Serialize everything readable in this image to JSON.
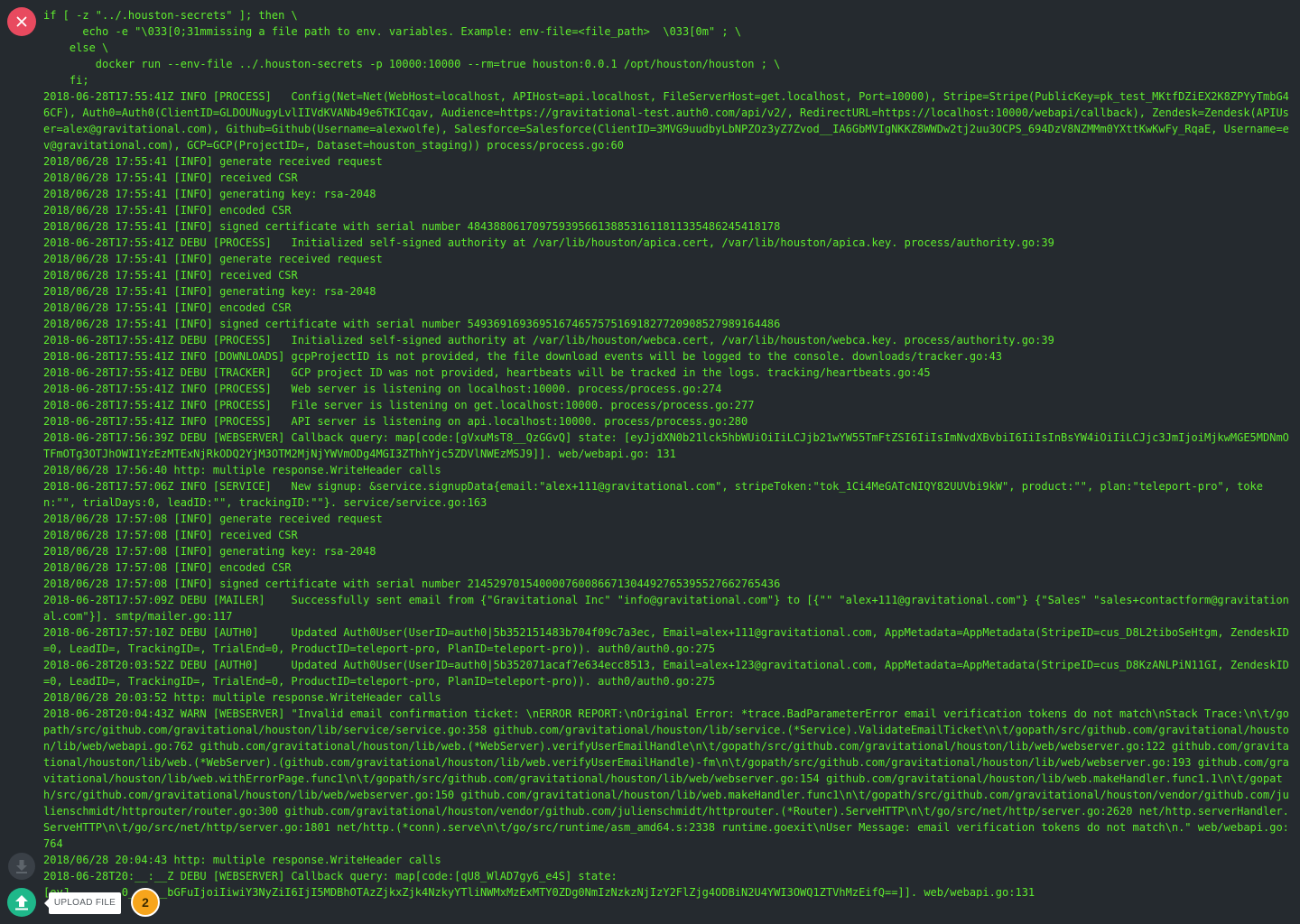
{
  "log_lines": [
    "if [ -z \"../.houston-secrets\" ]; then \\",
    "      echo -e \"\\033[0;31mmissing a file path to env. variables. Example: env-file=<file_path>  \\033[0m\" ; \\",
    "    else \\",
    "        docker run --env-file ../.houston-secrets -p 10000:10000 --rm=true houston:0.0.1 /opt/houston/houston ; \\",
    "    fi;",
    "2018-06-28T17:55:41Z INFO [PROCESS]   Config(Net=Net(WebHost=localhost, APIHost=api.localhost, FileServerHost=get.localhost, Port=10000), Stripe=Stripe(PublicKey=pk_test_MKtfDZiEX2K8ZPYyTmbG46CF), Auth0=Auth0(ClientID=GLDOUNugyLvlIIVdKVANb49e6TKICqav, Audience=https://gravitational-test.auth0.com/api/v2/, RedirectURL=https://localhost:10000/webapi/callback), Zendesk=Zendesk(APIUser=alex@gravitational.com), Github=Github(Username=alexwolfe), Salesforce=Salesforce(ClientID=3MVG9uudbyLbNPZOz3yZ7Zvod__IA6GbMVIgNKKZ8WWDw2tj2uu3OCPS_694DzV8NZMMm0YXttKwKwFy_RqaE, Username=ev@gravitational.com), GCP=GCP(ProjectID=, Dataset=houston_staging)) process/process.go:60",
    "2018/06/28 17:55:41 [INFO] generate received request",
    "2018/06/28 17:55:41 [INFO] received CSR",
    "2018/06/28 17:55:41 [INFO] generating key: rsa-2048",
    "2018/06/28 17:55:41 [INFO] encoded CSR",
    "2018/06/28 17:55:41 [INFO] signed certificate with serial number 484388061709759395661388531611811335486245418178",
    "2018-06-28T17:55:41Z DEBU [PROCESS]   Initialized self-signed authority at /var/lib/houston/apica.cert, /var/lib/houston/apica.key. process/authority.go:39",
    "2018/06/28 17:55:41 [INFO] generate received request",
    "2018/06/28 17:55:41 [INFO] received CSR",
    "2018/06/28 17:55:41 [INFO] generating key: rsa-2048",
    "2018/06/28 17:55:41 [INFO] encoded CSR",
    "2018/06/28 17:55:41 [INFO] signed certificate with serial number 549369169369516746575751691827720908527989164486",
    "2018-06-28T17:55:41Z DEBU [PROCESS]   Initialized self-signed authority at /var/lib/houston/webca.cert, /var/lib/houston/webca.key. process/authority.go:39",
    "2018-06-28T17:55:41Z INFO [DOWNLOADS] gcpProjectID is not provided, the file download events will be logged to the console. downloads/tracker.go:43",
    "2018-06-28T17:55:41Z DEBU [TRACKER]   GCP project ID was not provided, heartbeats will be tracked in the logs. tracking/heartbeats.go:45",
    "2018-06-28T17:55:41Z INFO [PROCESS]   Web server is listening on localhost:10000. process/process.go:274",
    "2018-06-28T17:55:41Z INFO [PROCESS]   File server is listening on get.localhost:10000. process/process.go:277",
    "2018-06-28T17:55:41Z INFO [PROCESS]   API server is listening on api.localhost:10000. process/process.go:280",
    "2018-06-28T17:56:39Z DEBU [WEBSERVER] Callback query: map[code:[gVxuMsT8__QzGGvQ] state: [eyJjdXN0b21lck5hbWUiOiIiLCJjb21wYW55TmFtZSI6IiIsImNvdXBvbiI6IiIsInBsYW4iOiIiLCJjc3JmIjoiMjkwMGE5MDNmOTFmOTg3OTJhOWI1YzEzMTExNjRkODQ2YjM3OTM2MjNjYWVmODg4MGI3ZThhYjc5ZDVlNWEzMSJ9]]. web/webapi.go: 131",
    "2018/06/28 17:56:40 http: multiple response.WriteHeader calls",
    "2018-06-28T17:57:06Z INFO [SERVICE]   New signup: &service.signupData{email:\"alex+111@gravitational.com\", stripeToken:\"tok_1Ci4MeGATcNIQY82UUVbi9kW\", product:\"\", plan:\"teleport-pro\", token:\"\", trialDays:0, leadID:\"\", trackingID:\"\"}. service/service.go:163",
    "2018/06/28 17:57:08 [INFO] generate received request",
    "2018/06/28 17:57:08 [INFO] received CSR",
    "2018/06/28 17:57:08 [INFO] generating key: rsa-2048",
    "2018/06/28 17:57:08 [INFO] encoded CSR",
    "2018/06/28 17:57:08 [INFO] signed certificate with serial number 214529701540000760086671304492765395527662765436",
    "2018-06-28T17:57:09Z DEBU [MAILER]    Successfully sent email from {\"Gravitational Inc\" \"info@gravitational.com\"} to [{\"\" \"alex+111@gravitational.com\"} {\"Sales\" \"sales+contactform@gravitational.com\"}]. smtp/mailer.go:117",
    "2018-06-28T17:57:10Z DEBU [AUTH0]     Updated Auth0User(UserID=auth0|5b352151483b704f09c7a3ec, Email=alex+111@gravitational.com, AppMetadata=AppMetadata(StripeID=cus_D8L2tiboSeHtgm, ZendeskID=0, LeadID=, TrackingID=, TrialEnd=0, ProductID=teleport-pro, PlanID=teleport-pro)). auth0/auth0.go:275",
    "2018-06-28T20:03:52Z DEBU [AUTH0]     Updated Auth0User(UserID=auth0|5b352071acaf7e634ecc8513, Email=alex+123@gravitational.com, AppMetadata=AppMetadata(StripeID=cus_D8KzANLPiN11GI, ZendeskID=0, LeadID=, TrackingID=, TrialEnd=0, ProductID=teleport-pro, PlanID=teleport-pro)). auth0/auth0.go:275",
    "2018/06/28 20:03:52 http: multiple response.WriteHeader calls",
    "2018-06-28T20:04:43Z WARN [WEBSERVER] \"Invalid email confirmation ticket: \\nERROR REPORT:\\nOriginal Error: *trace.BadParameterError email verification tokens do not match\\nStack Trace:\\n\\t/gopath/src/github.com/gravitational/houston/lib/service/service.go:358 github.com/gravitational/houston/lib/service.(*Service).ValidateEmailTicket\\n\\t/gopath/src/github.com/gravitational/houston/lib/web/webapi.go:762 github.com/gravitational/houston/lib/web.(*WebServer).verifyUserEmailHandle\\n\\t/gopath/src/github.com/gravitational/houston/lib/web/webserver.go:122 github.com/gravitational/houston/lib/web.(*WebServer).(github.com/gravitational/houston/lib/web.verifyUserEmailHandle)-fm\\n\\t/gopath/src/github.com/gravitational/houston/lib/web/webserver.go:193 github.com/gravitational/houston/lib/web.withErrorPage.func1\\n\\t/gopath/src/github.com/gravitational/houston/lib/web/webserver.go:154 github.com/gravitational/houston/lib/web.makeHandler.func1.1\\n\\t/gopath/src/github.com/gravitational/houston/lib/web/webserver.go:150 github.com/gravitational/houston/lib/web.makeHandler.func1\\n\\t/gopath/src/github.com/gravitational/houston/vendor/github.com/julienschmidt/httprouter/router.go:300 github.com/gravitational/houston/vendor/github.com/julienschmidt/httprouter.(*Router).ServeHTTP\\n\\t/go/src/net/http/server.go:2620 net/http.serverHandler.ServeHTTP\\n\\t/go/src/net/http/server.go:1801 net/http.(*conn).serve\\n\\t/go/src/runtime/asm_amd64.s:2338 runtime.goexit\\nUser Message: email verification tokens do not match\\n.\" web/webapi.go:764",
    "2018/06/28 20:04:43 http: multiple response.WriteHeader calls",
    "2018-06-28T20:__:__Z DEBU [WEBSERVER] Callback query: map[code:[qU8_WlAD7gy6_e4S] state:",
    "[eyJ______..0______bGFuIjoiIiwiY3NyZiI6IjI5MDBhOTAzZjkxZjk4NzkyYTliNWMxMzExMTY0ZDg0NmIzNzkzNjIzY2FlZjg4ODBiN2U4YWI3OWQ1ZTVhMzEifQ==]]. web/webapi.go:131"
  ],
  "controls": {
    "upload_tooltip": "UPLOAD FILE",
    "step_number": "2"
  },
  "colors": {
    "background": "#252a2f",
    "log_text": "#5fec2e",
    "close_button": "#e84a5f",
    "upload_button": "#1fb88a",
    "step_badge": "#f7a51c"
  },
  "icons": {
    "close": "close-icon",
    "download": "download-icon",
    "upload": "upload-icon"
  }
}
